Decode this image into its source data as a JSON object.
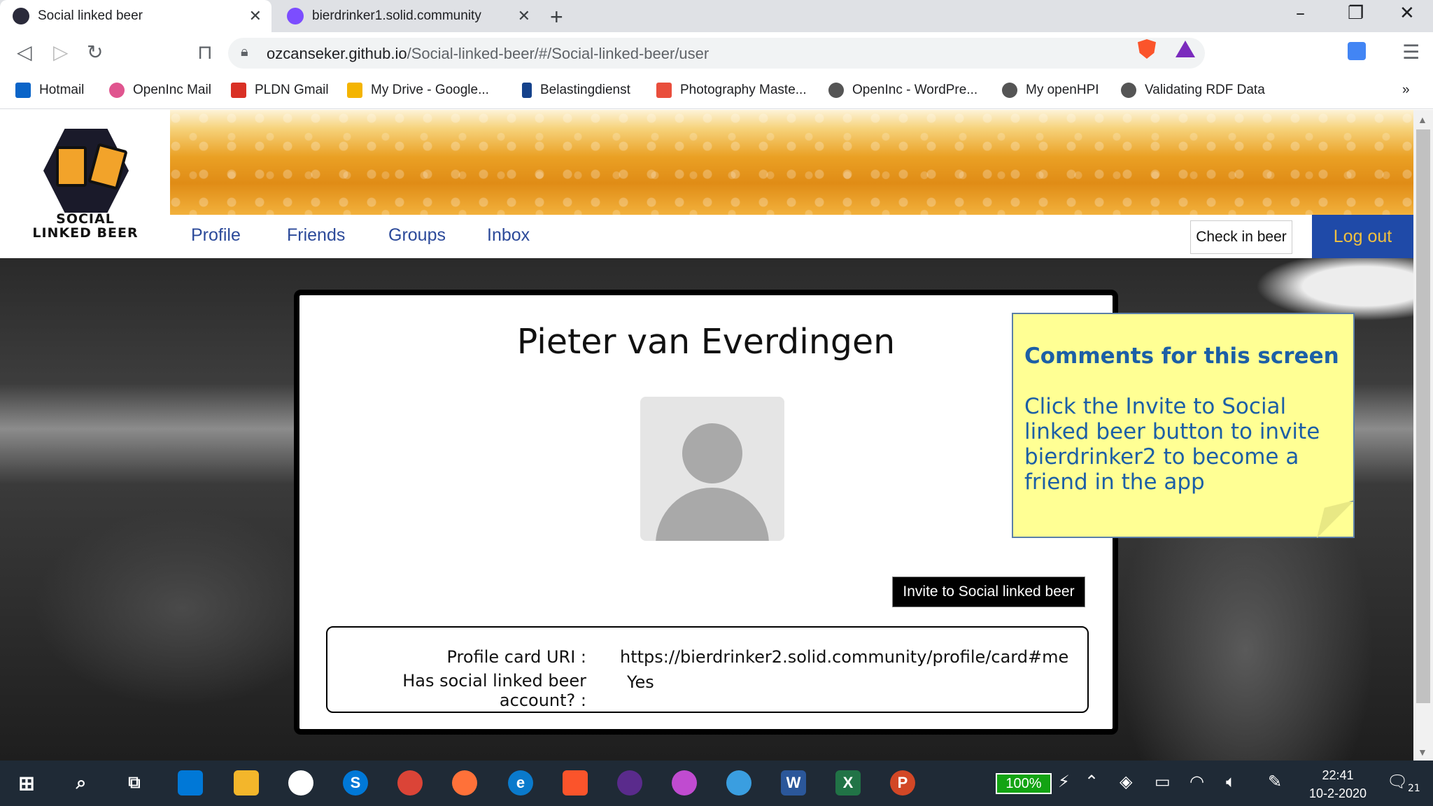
{
  "browser": {
    "tabs": [
      {
        "title": "Social linked beer",
        "active": true
      },
      {
        "title": "bierdrinker1.solid.community",
        "active": false
      }
    ],
    "url_host": "ozcanseker.github.io",
    "url_path": "/Social-linked-beer/#/Social-linked-beer/user",
    "bookmarks": [
      "Hotmail",
      "OpenInc Mail",
      "PLDN Gmail",
      "My Drive - Google...",
      "Belastingdienst",
      "Photography Maste...",
      "OpenInc - WordPre...",
      "My openHPI",
      "Validating RDF Data"
    ],
    "overflow": "»"
  },
  "app": {
    "logo_line1": "SOCIAL",
    "logo_line2": "LINKED BEER",
    "nav": [
      "Profile",
      "Friends",
      "Groups",
      "Inbox"
    ],
    "check_in_label": "Check in beer",
    "logout_label": "Log out"
  },
  "profile": {
    "name": "Pieter van Everdingen",
    "invite_label": "Invite to Social linked beer",
    "uri_label": "Profile card URI :",
    "uri_value": "https://bierdrinker2.solid.community/profile/card#me",
    "account_label": "Has social linked beer account? :",
    "account_value": "Yes"
  },
  "note": {
    "title": "Comments for this screen",
    "body": "Click the Invite to Social linked beer button to invite bierdrinker2 to become a friend in the app"
  },
  "taskbar": {
    "battery": "100%",
    "time": "22:41",
    "date": "10-2-2020",
    "notifications": "21"
  },
  "colors": {
    "nav_link": "#2c4a9a",
    "logout_bg": "#1f4aa8",
    "note_bg": "#ffff94",
    "note_text": "#1c5fa6"
  }
}
